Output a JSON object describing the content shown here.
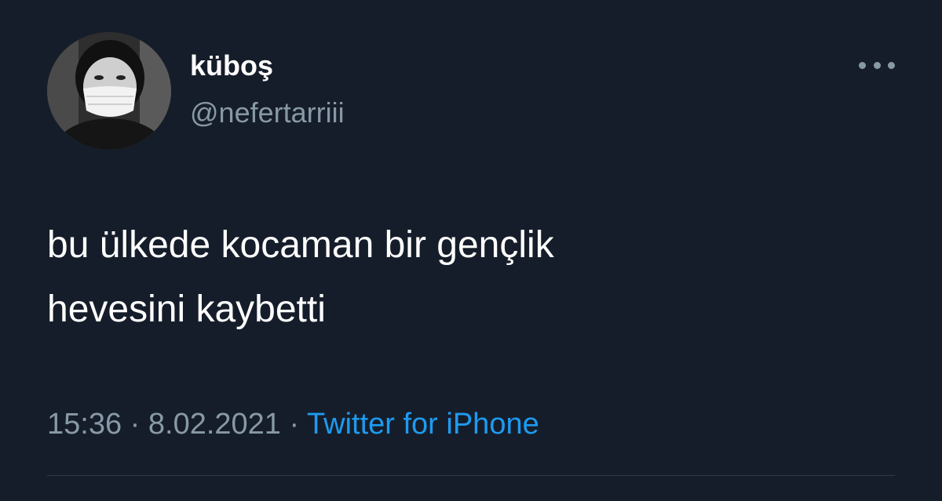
{
  "tweet": {
    "author": {
      "display_name": "küboş",
      "handle": "@nefertarriii",
      "avatar_icon": "profile-photo"
    },
    "text_lines": [
      "bu ülkede kocaman bir gençlik",
      "hevesini kaybetti"
    ],
    "meta": {
      "time": "15:36",
      "separator": " · ",
      "date": "8.02.2021",
      "source": "Twitter for iPhone"
    },
    "more_icon": "more-options-icon"
  },
  "colors": {
    "background": "#161d2a",
    "text_primary": "#ffffff",
    "text_secondary": "#8899a6",
    "link": "#1d9bf0",
    "divider": "#2f3b4b"
  }
}
